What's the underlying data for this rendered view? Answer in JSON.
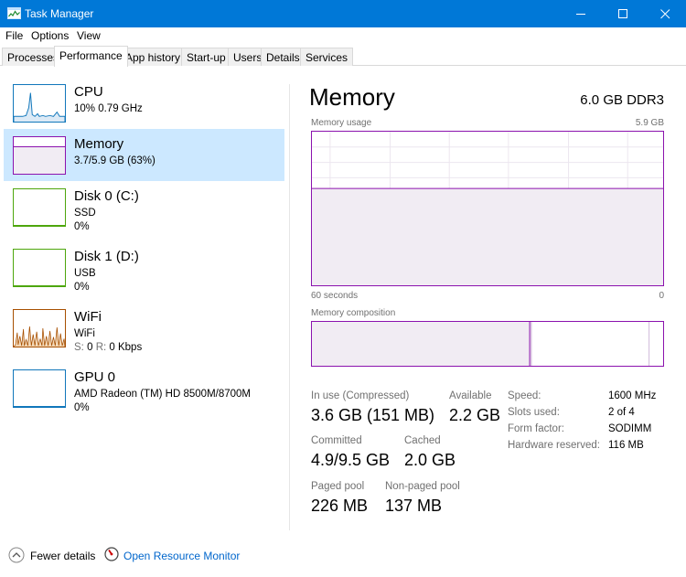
{
  "window": {
    "title": "Task Manager"
  },
  "menu": {
    "file": "File",
    "options": "Options",
    "view": "View"
  },
  "tabs": [
    "Processes",
    "Performance",
    "App history",
    "Start-up",
    "Users",
    "Details",
    "Services"
  ],
  "resources": [
    {
      "name": "CPU",
      "line1": "10%  0.79 GHz",
      "line2": "",
      "color": "#1177bb"
    },
    {
      "name": "Memory",
      "line1": "3.7/5.9 GB (63%)",
      "line2": "",
      "color": "#8b12ae"
    },
    {
      "name": "Disk 0 (C:)",
      "line1": "SSD",
      "line2": "0%",
      "color": "#4da60c"
    },
    {
      "name": "Disk 1 (D:)",
      "line1": "USB",
      "line2": "0%",
      "color": "#4da60c"
    },
    {
      "name": "WiFi",
      "line1": "WiFi",
      "line2_s": "S:",
      "line2_sv": "0",
      "line2_r": "R:",
      "line2_rv": "0 Kbps",
      "color": "#a74f01"
    },
    {
      "name": "GPU 0",
      "line1": "AMD Radeon (TM) HD 8500M/8700M",
      "line2": "0%",
      "color": "#1177bb"
    }
  ],
  "detail": {
    "title": "Memory",
    "spec": "6.0 GB DDR3",
    "usage_label": "Memory usage",
    "usage_max": "5.9 GB",
    "time_label": "60 seconds",
    "time_zero": "0",
    "usage_fraction": 0.63,
    "composition_label": "Memory composition",
    "composition": {
      "in_use_fraction": 0.62,
      "modified_fraction": 0.005,
      "standby_fraction": 0.335
    },
    "in_use_label": "In use (Compressed)",
    "in_use_value": "3.6 GB (151 MB)",
    "available_label": "Available",
    "available_value": "2.2 GB",
    "committed_label": "Committed",
    "committed_value": "4.9/9.5 GB",
    "cached_label": "Cached",
    "cached_value": "2.0 GB",
    "paged_label": "Paged pool",
    "paged_value": "226 MB",
    "nonpaged_label": "Non-paged pool",
    "nonpaged_value": "137 MB",
    "props": [
      {
        "label": "Speed:",
        "value": "1600 MHz"
      },
      {
        "label": "Slots used:",
        "value": "2 of 4"
      },
      {
        "label": "Form factor:",
        "value": "SODIMM"
      },
      {
        "label": "Hardware reserved:",
        "value": "116 MB"
      }
    ]
  },
  "footer": {
    "fewer_details": "Fewer details",
    "open_rm": "Open Resource Monitor"
  },
  "colors": {
    "titlebar": "#0078d7",
    "selected": "#cce8ff",
    "memory": "#8b12ae",
    "link": "#0066cc"
  }
}
